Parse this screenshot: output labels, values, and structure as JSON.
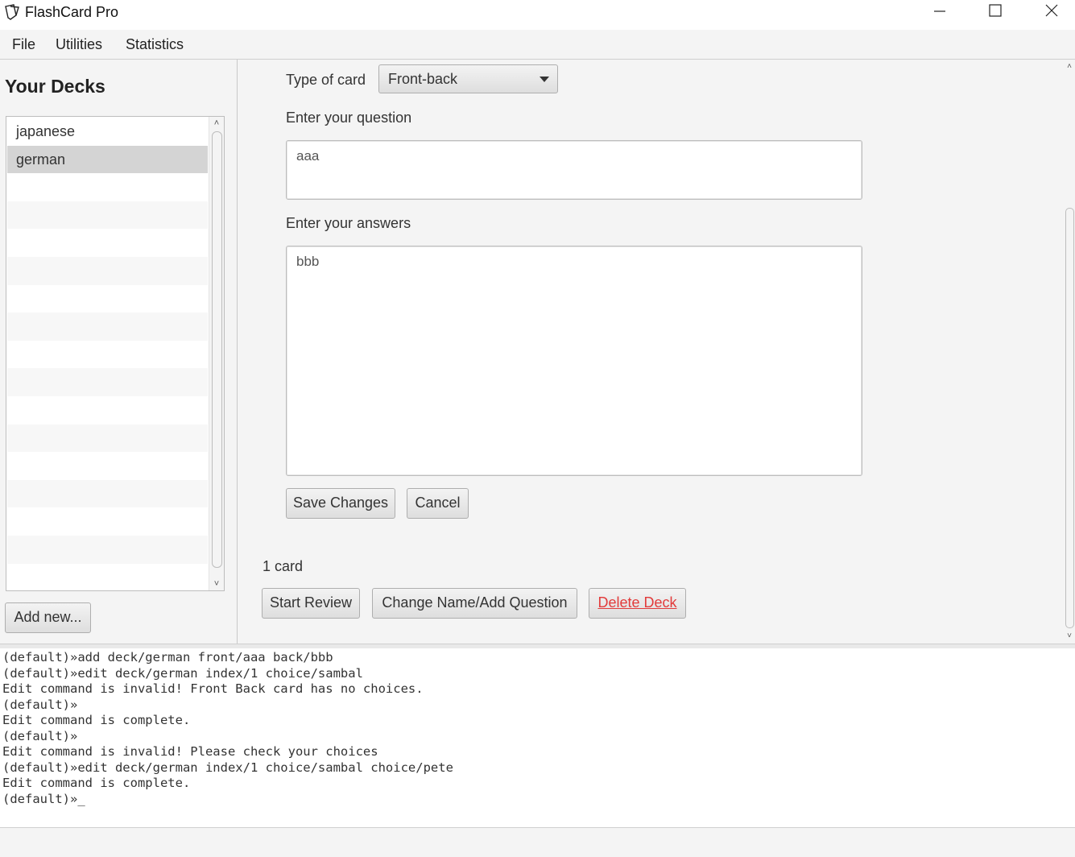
{
  "window": {
    "title": "FlashCard Pro",
    "controls": [
      "minimize-icon",
      "maximize-icon",
      "close-icon"
    ]
  },
  "menu": {
    "items": [
      "File",
      "Utilities",
      "Statistics"
    ]
  },
  "sidebar": {
    "title": "Your Decks",
    "decks": [
      "japanese",
      "german"
    ],
    "selected": "german",
    "add_button": "Add new..."
  },
  "editor": {
    "type_label": "Type of card",
    "type_value": "Front-back",
    "question_label": "Enter your question",
    "question_value": "aaa",
    "answers_label": "Enter your answers",
    "answers_value": "bbb",
    "save_button": "Save Changes",
    "cancel_button": "Cancel"
  },
  "deck_info": {
    "card_count": "1 card",
    "start_review_button": "Start Review",
    "change_button": "Change Name/Add Question",
    "delete_button": "Delete Deck"
  },
  "console": {
    "lines": [
      "(default)»add deck/german front/aaa back/bbb",
      "(default)»edit deck/german index/1 choice/sambal",
      "Edit command is invalid! Front Back card has no choices.",
      "(default)»",
      "Edit command is complete.",
      "(default)»",
      "Edit command is invalid! Please check your choices",
      "(default)»edit deck/german index/1 choice/sambal choice/pete",
      "Edit command is complete.",
      "(default)»_"
    ]
  },
  "colors": {
    "delete_text": "#e23b3b",
    "selected_row": "#d4d4d4"
  }
}
